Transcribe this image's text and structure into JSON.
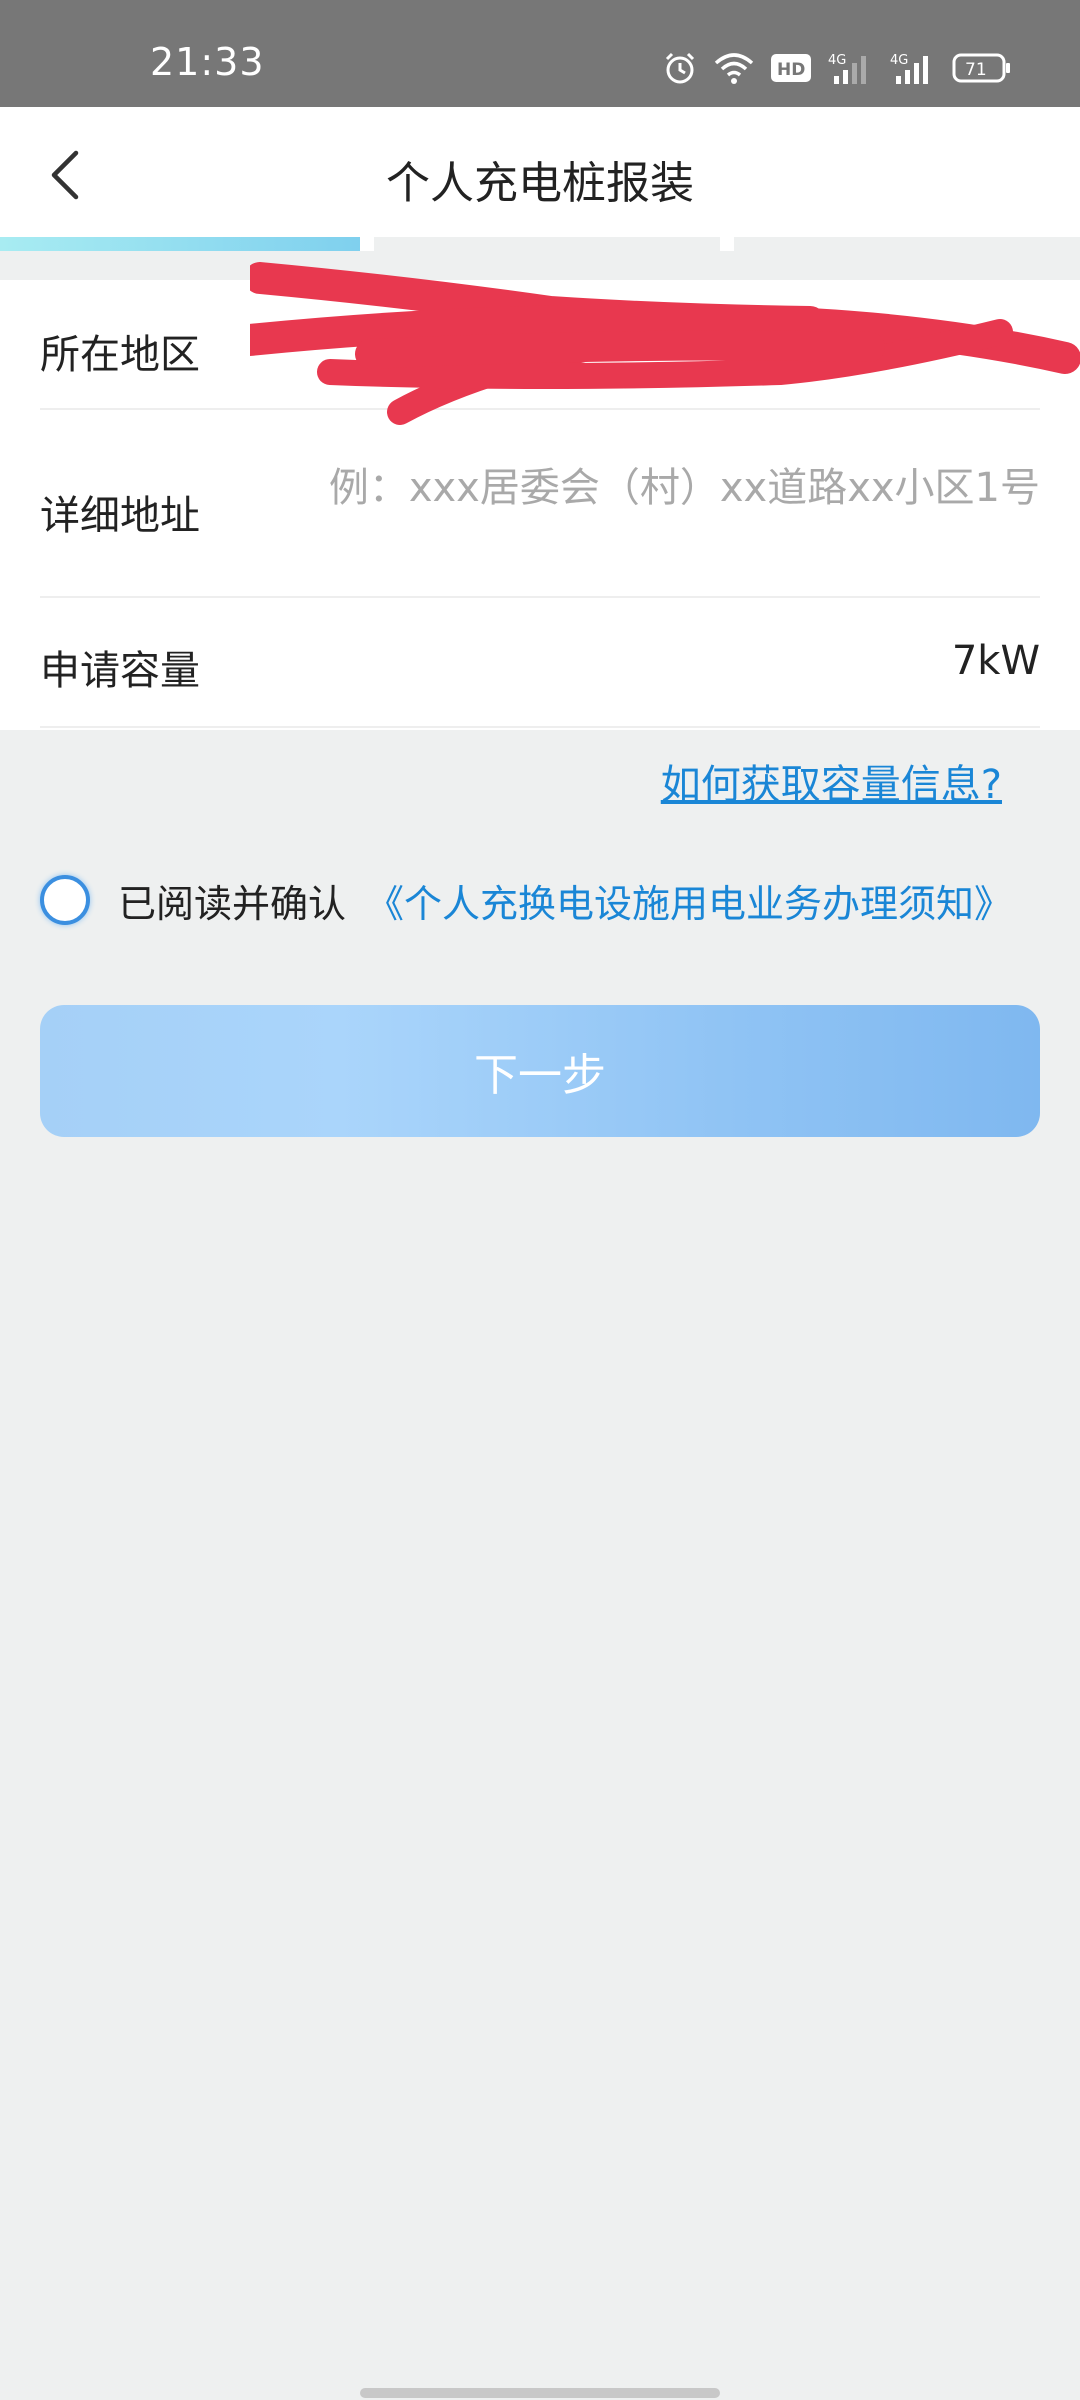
{
  "status_bar": {
    "time": "21:33",
    "icons": [
      "alarm-icon",
      "wifi-icon",
      "hd-icon",
      "signal-4g-icon",
      "signal-4g-icon",
      "battery-icon"
    ],
    "hd_label": "HD",
    "network_1": "4G",
    "network_2": "4G",
    "battery_level": "71"
  },
  "header": {
    "title": "个人充电桩报装",
    "back_icon": "chevron-left-icon"
  },
  "progress": {
    "total_steps": 3,
    "current_step": 1,
    "active_color": "#7fd0ee"
  },
  "form": {
    "region_label": "所在地区",
    "address_label": "详细地址",
    "address_placeholder": "例：xxx居委会（村）xx道路xx小区1号",
    "capacity_label": "申请容量",
    "capacity_value": "7kW"
  },
  "capacity_help_link": "如何获取容量信息?",
  "agreement": {
    "prefix": "已阅读并确认",
    "link_text": "《个人充换电设施用电业务办理须知》",
    "checked": false
  },
  "next_button": {
    "label": "下一步"
  },
  "colors": {
    "accent": "#1a86d6",
    "button_start": "#a5d0f7",
    "button_end": "#7fb8f0",
    "redaction": "#e8384f",
    "page_bg": "#eef0f0"
  }
}
